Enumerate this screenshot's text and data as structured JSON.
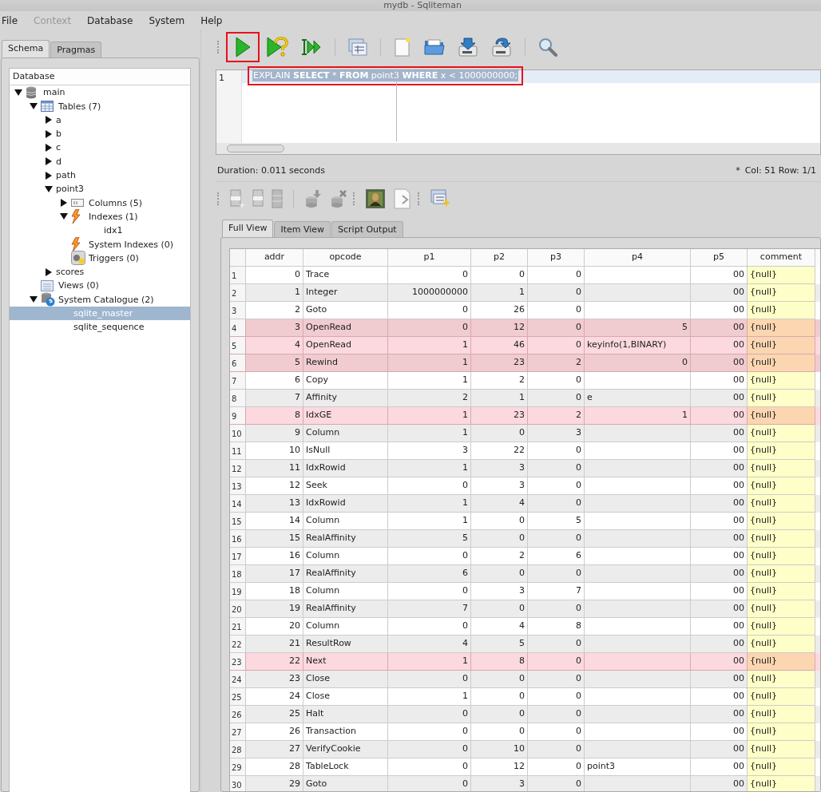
{
  "window": {
    "title": "mydb - Sqliteman"
  },
  "menu": [
    {
      "label": "File",
      "disabled": false
    },
    {
      "label": "Context",
      "disabled": true
    },
    {
      "label": "Database",
      "disabled": false
    },
    {
      "label": "System",
      "disabled": false
    },
    {
      "label": "Help",
      "disabled": false
    }
  ],
  "side_tabs": [
    {
      "label": "Schema",
      "selected": true
    },
    {
      "label": "Pragmas",
      "selected": false
    }
  ],
  "tree": {
    "header": "Database",
    "items": [
      {
        "label": "main",
        "kind": "database",
        "expanded": true,
        "selected": false,
        "children": [
          {
            "label": "Tables (7)",
            "kind": "tables",
            "expanded": true,
            "selected": false,
            "children": [
              {
                "label": "a",
                "kind": "table",
                "expanded": false,
                "selected": false
              },
              {
                "label": "b",
                "kind": "table",
                "expanded": false,
                "selected": false
              },
              {
                "label": "c",
                "kind": "table",
                "expanded": false,
                "selected": false
              },
              {
                "label": "d",
                "kind": "table",
                "expanded": false,
                "selected": false
              },
              {
                "label": "path",
                "kind": "table",
                "expanded": false,
                "selected": false
              },
              {
                "label": "point3",
                "kind": "table",
                "expanded": true,
                "selected": false,
                "children": [
                  {
                    "label": "Columns (5)",
                    "kind": "columns",
                    "expanded": false,
                    "selected": false
                  },
                  {
                    "label": "Indexes (1)",
                    "kind": "indexes",
                    "expanded": true,
                    "selected": false,
                    "children": [
                      {
                        "label": "idx1",
                        "kind": "leaf",
                        "selected": false
                      }
                    ]
                  },
                  {
                    "label": "System Indexes (0)",
                    "kind": "indexes",
                    "selected": false
                  },
                  {
                    "label": "Triggers (0)",
                    "kind": "triggers",
                    "selected": false
                  }
                ]
              },
              {
                "label": "scores",
                "kind": "table",
                "expanded": false,
                "selected": false
              }
            ]
          },
          {
            "label": "Views (0)",
            "kind": "views",
            "selected": false
          },
          {
            "label": "System Catalogue (2)",
            "kind": "catalogue",
            "expanded": true,
            "selected": false,
            "children": [
              {
                "label": "sqlite_master",
                "kind": "leaf",
                "selected": true
              },
              {
                "label": "sqlite_sequence",
                "kind": "leaf",
                "selected": false
              }
            ]
          }
        ]
      }
    ]
  },
  "toolbar": [
    {
      "kind": "run",
      "annotated": true
    },
    {
      "kind": "explain",
      "annotated": false
    },
    {
      "kind": "script",
      "annotated": false
    },
    {
      "kind": "sep"
    },
    {
      "kind": "grid",
      "annotated": false
    },
    {
      "kind": "sep"
    },
    {
      "kind": "new",
      "annotated": false
    },
    {
      "kind": "open",
      "annotated": false
    },
    {
      "kind": "save",
      "annotated": false
    },
    {
      "kind": "saveas",
      "annotated": false
    },
    {
      "kind": "sep"
    },
    {
      "kind": "search",
      "annotated": false
    }
  ],
  "editor": {
    "line_number": "1",
    "query": "EXPLAIN **SELECT** * **FROM** point3 **WHERE** x < 1000000000;",
    "query_selected": true,
    "annotated": true
  },
  "status": {
    "duration": "Duration: 0.011 seconds",
    "modified": "*",
    "position": "Col: 51 Row: 1/1"
  },
  "result_tabs": [
    {
      "label": "Full View",
      "selected": true
    },
    {
      "label": "Item View",
      "selected": false
    },
    {
      "label": "Script Output",
      "selected": false
    }
  ],
  "table": {
    "columns": [
      "addr",
      "opcode",
      "p1",
      "p2",
      "p3",
      "p4",
      "p5",
      "comment"
    ],
    "rows": [
      {
        "n": "1",
        "cells": [
          "0",
          "Trace",
          "0",
          "0",
          "0",
          "",
          "00",
          "{null}"
        ],
        "highlight": false
      },
      {
        "n": "2",
        "cells": [
          "1",
          "Integer",
          "1000000000",
          "1",
          "0",
          "",
          "00",
          "{null}"
        ],
        "highlight": false
      },
      {
        "n": "3",
        "cells": [
          "2",
          "Goto",
          "0",
          "26",
          "0",
          "",
          "00",
          "{null}"
        ],
        "highlight": false
      },
      {
        "n": "4",
        "cells": [
          "3",
          "OpenRead",
          "0",
          "12",
          "0",
          "5",
          "00",
          "{null}"
        ],
        "highlight": true
      },
      {
        "n": "5",
        "cells": [
          "4",
          "OpenRead",
          "1",
          "46",
          "0",
          "keyinfo(1,BINARY)",
          "00",
          "{null}"
        ],
        "highlight": true
      },
      {
        "n": "6",
        "cells": [
          "5",
          "Rewind",
          "1",
          "23",
          "2",
          "0",
          "00",
          "{null}"
        ],
        "highlight": true
      },
      {
        "n": "7",
        "cells": [
          "6",
          "Copy",
          "1",
          "2",
          "0",
          "",
          "00",
          "{null}"
        ],
        "highlight": false
      },
      {
        "n": "8",
        "cells": [
          "7",
          "Affinity",
          "2",
          "1",
          "0",
          "e",
          "00",
          "{null}"
        ],
        "highlight": false
      },
      {
        "n": "9",
        "cells": [
          "8",
          "IdxGE",
          "1",
          "23",
          "2",
          "1",
          "00",
          "{null}"
        ],
        "highlight": true
      },
      {
        "n": "10",
        "cells": [
          "9",
          "Column",
          "1",
          "0",
          "3",
          "",
          "00",
          "{null}"
        ],
        "highlight": false
      },
      {
        "n": "11",
        "cells": [
          "10",
          "IsNull",
          "3",
          "22",
          "0",
          "",
          "00",
          "{null}"
        ],
        "highlight": false
      },
      {
        "n": "12",
        "cells": [
          "11",
          "IdxRowid",
          "1",
          "3",
          "0",
          "",
          "00",
          "{null}"
        ],
        "highlight": false
      },
      {
        "n": "13",
        "cells": [
          "12",
          "Seek",
          "0",
          "3",
          "0",
          "",
          "00",
          "{null}"
        ],
        "highlight": false
      },
      {
        "n": "14",
        "cells": [
          "13",
          "IdxRowid",
          "1",
          "4",
          "0",
          "",
          "00",
          "{null}"
        ],
        "highlight": false
      },
      {
        "n": "15",
        "cells": [
          "14",
          "Column",
          "1",
          "0",
          "5",
          "",
          "00",
          "{null}"
        ],
        "highlight": false
      },
      {
        "n": "16",
        "cells": [
          "15",
          "RealAffinity",
          "5",
          "0",
          "0",
          "",
          "00",
          "{null}"
        ],
        "highlight": false
      },
      {
        "n": "17",
        "cells": [
          "16",
          "Column",
          "0",
          "2",
          "6",
          "",
          "00",
          "{null}"
        ],
        "highlight": false
      },
      {
        "n": "18",
        "cells": [
          "17",
          "RealAffinity",
          "6",
          "0",
          "0",
          "",
          "00",
          "{null}"
        ],
        "highlight": false
      },
      {
        "n": "19",
        "cells": [
          "18",
          "Column",
          "0",
          "3",
          "7",
          "",
          "00",
          "{null}"
        ],
        "highlight": false
      },
      {
        "n": "20",
        "cells": [
          "19",
          "RealAffinity",
          "7",
          "0",
          "0",
          "",
          "00",
          "{null}"
        ],
        "highlight": false
      },
      {
        "n": "21",
        "cells": [
          "20",
          "Column",
          "0",
          "4",
          "8",
          "",
          "00",
          "{null}"
        ],
        "highlight": false
      },
      {
        "n": "22",
        "cells": [
          "21",
          "ResultRow",
          "4",
          "5",
          "0",
          "",
          "00",
          "{null}"
        ],
        "highlight": false
      },
      {
        "n": "23",
        "cells": [
          "22",
          "Next",
          "1",
          "8",
          "0",
          "",
          "00",
          "{null}"
        ],
        "highlight": true
      },
      {
        "n": "24",
        "cells": [
          "23",
          "Close",
          "0",
          "0",
          "0",
          "",
          "00",
          "{null}"
        ],
        "highlight": false
      },
      {
        "n": "25",
        "cells": [
          "24",
          "Close",
          "1",
          "0",
          "0",
          "",
          "00",
          "{null}"
        ],
        "highlight": false
      },
      {
        "n": "26",
        "cells": [
          "25",
          "Halt",
          "0",
          "0",
          "0",
          "",
          "00",
          "{null}"
        ],
        "highlight": false
      },
      {
        "n": "27",
        "cells": [
          "26",
          "Transaction",
          "0",
          "0",
          "0",
          "",
          "00",
          "{null}"
        ],
        "highlight": false
      },
      {
        "n": "28",
        "cells": [
          "27",
          "VerifyCookie",
          "0",
          "10",
          "0",
          "",
          "00",
          "{null}"
        ],
        "highlight": false
      },
      {
        "n": "29",
        "cells": [
          "28",
          "TableLock",
          "0",
          "12",
          "0",
          "point3",
          "00",
          "{null}"
        ],
        "highlight": false
      },
      {
        "n": "30",
        "cells": [
          "29",
          "Goto",
          "0",
          "3",
          "0",
          "",
          "00",
          "{null}"
        ],
        "highlight": false
      }
    ]
  }
}
